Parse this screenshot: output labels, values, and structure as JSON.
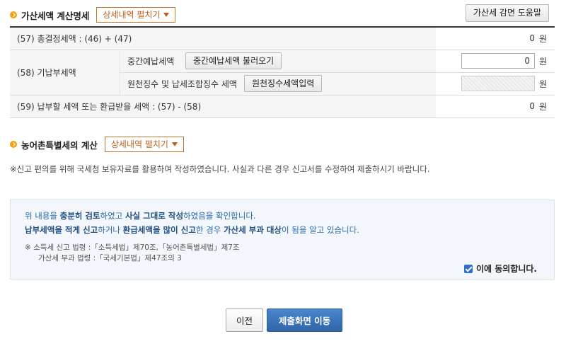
{
  "section1": {
    "title": "가산세액 계산명세",
    "expand_label": "상세내역 펼치기",
    "help_button": "가산세 감면 도움말"
  },
  "rows": {
    "r57": {
      "label": "(57) 총결정세액 : (46) + (47)",
      "value": "0",
      "unit": "원"
    },
    "r58": {
      "label": "(58) 기납부세액",
      "interim": {
        "label": "중간예납세액",
        "button": "중간예납세액 불러오기",
        "value": "0",
        "unit": "원"
      },
      "withholding": {
        "label": "원천징수 및 납세조합징수 세액",
        "button": "원천징수세액입력",
        "value": "",
        "unit": "원"
      }
    },
    "r59": {
      "label": "(59) 납부할 세액 또는 환급받을 세액 : (57) - (58)",
      "value": "0",
      "unit": "원"
    }
  },
  "section2": {
    "title": "농어촌특별세의 계산",
    "expand_label": "상세내역 펼치기"
  },
  "notice": "※신고 편의를 위해 국세청 보유자료를 활용하여 작성하였습니다. 사실과 다른 경우 신고서를 수정하여 제출하시기 바랍니다.",
  "confirm": {
    "line1_a": "위 내용을 ",
    "line1_b": "충분히 검토",
    "line1_c": "하였고 ",
    "line1_d": "사실 그대로 작성",
    "line1_e": "하였음을 확인합니다.",
    "line2_a": "납부세액을 적게 신고",
    "line2_b": "하거나 ",
    "line2_c": "환급세액을 많이 신고",
    "line2_d": "한 경우 ",
    "line2_e": "가산세 부과 대상",
    "line2_f": "이 됨을 알고 있습니다.",
    "law1": "※ 소득세 신고 법령 :「소득세법」제70조,「농어촌특별세법」제7조",
    "law2": "가산세 부과 법령 :「국세기본법」제47조의 3",
    "agree_label": "이에 동의합니다.",
    "agree_checked": true
  },
  "footer": {
    "prev_label": "이전",
    "submit_label": "제출화면 이동"
  },
  "colors": {
    "accent_orange": "#c0601a",
    "primary_blue": "#2f64a8"
  }
}
